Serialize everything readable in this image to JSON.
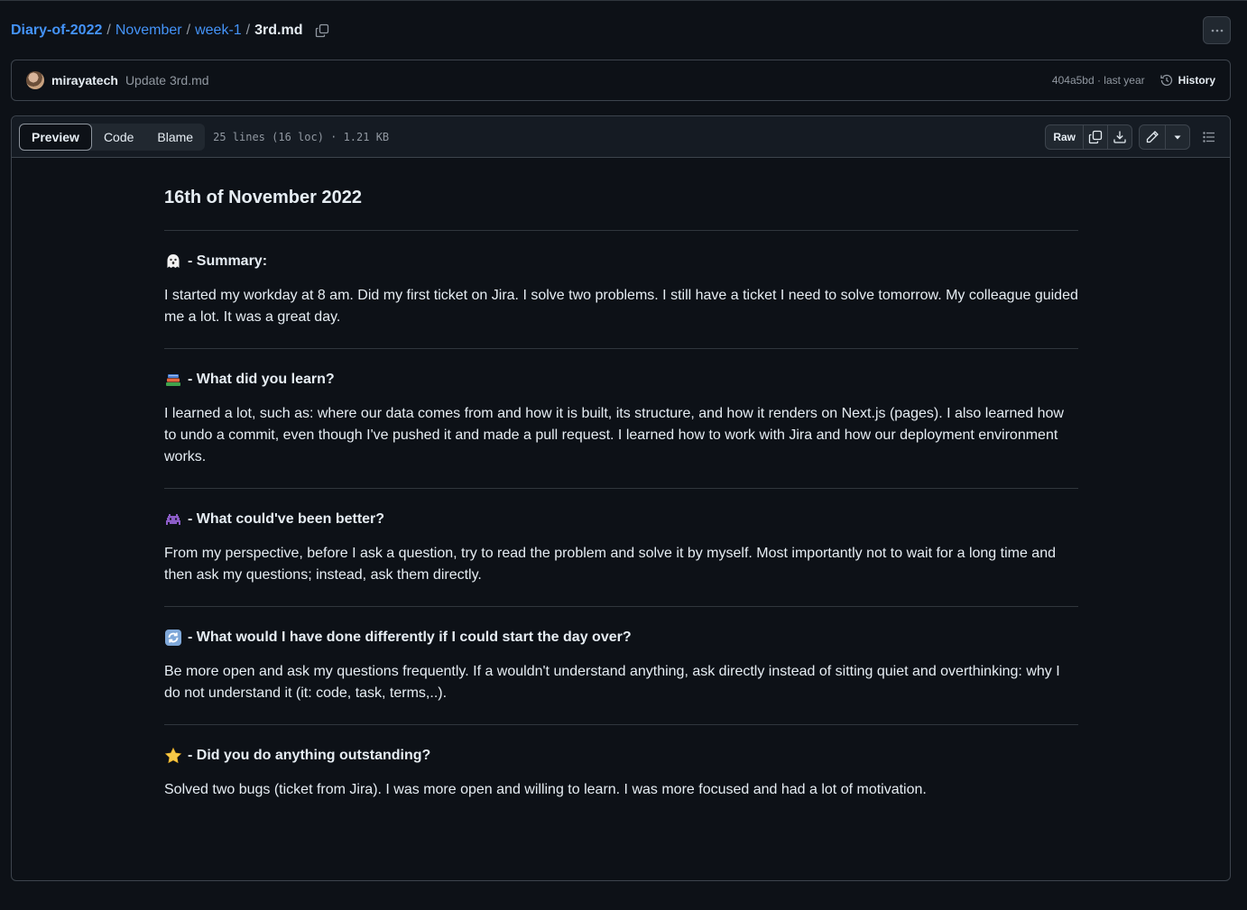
{
  "breadcrumb": {
    "repo": "Diary-of-2022",
    "folders": [
      "November",
      "week-1"
    ],
    "separator": "/",
    "file": "3rd.md"
  },
  "commit": {
    "author": "mirayatech",
    "message": "Update 3rd.md",
    "sha_time": "404a5bd · last year",
    "history_label": "History"
  },
  "file_header": {
    "tabs": [
      {
        "label": "Preview",
        "active": true
      },
      {
        "label": "Code",
        "active": false
      },
      {
        "label": "Blame",
        "active": false
      }
    ],
    "info": "25 lines (16 loc) · 1.21 KB",
    "raw_label": "Raw"
  },
  "content": {
    "title": "16th of November 2022",
    "sections": [
      {
        "emoji": "ghost-icon",
        "heading": "- Summary:",
        "body": "I started my workday at 8 am. Did my first ticket on Jira. I solve two problems. I still have a ticket I need to solve tomorrow. My colleague guided me a lot. It was a great day."
      },
      {
        "emoji": "books-icon",
        "heading": "- What did you learn?",
        "body": "I learned a lot, such as: where our data comes from and how it is built, its structure, and how it renders on Next.js (pages). I also learned how to undo a commit, even though I've pushed it and made a pull request. I learned how to work with Jira and how our deployment environment works."
      },
      {
        "emoji": "alien-monster-icon",
        "heading": "- What could've been better?",
        "body": "From my perspective, before I ask a question, try to read the problem and solve it by myself. Most importantly not to wait for a long time and then ask my questions; instead, ask them directly."
      },
      {
        "emoji": "arrows-cycle-icon",
        "heading": "- What would I have done differently if I could start the day over?",
        "body": "Be more open and ask my questions frequently. If a wouldn't understand anything, ask directly instead of sitting quiet and overthinking: why I do not understand it (it: code, task, terms,..)."
      },
      {
        "emoji": "star-icon",
        "heading": "- Did you do anything outstanding?",
        "body": "Solved two bugs (ticket from Jira). I was more open and willing to learn. I was more focused and had a lot of motivation."
      }
    ]
  },
  "colors": {
    "background": "#0d1117",
    "link": "#4493f8",
    "border": "#3d444d",
    "muted": "#9198a1",
    "text": "#e6edf3"
  }
}
